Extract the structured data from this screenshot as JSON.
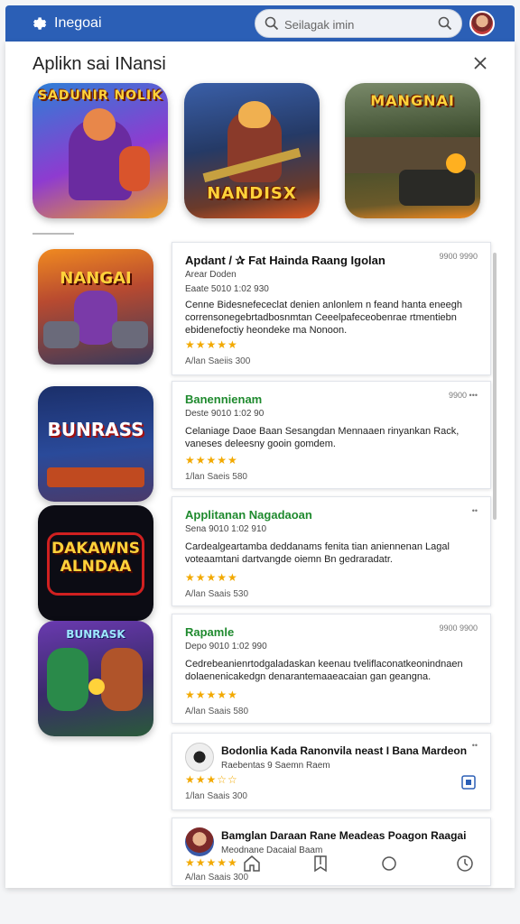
{
  "header": {
    "app_name": "Inegoai",
    "search_placeholder": "Seilagak imin",
    "icons": [
      "gear-icon",
      "search-icon",
      "avatar"
    ]
  },
  "sheet": {
    "title": "Aplikn sai INansi",
    "close_icon": "close-icon"
  },
  "featured": [
    {
      "art_text": "SADUNIR NOLIK",
      "colors": [
        "#2d7fd6",
        "#8e3bd0",
        "#f0a020"
      ]
    },
    {
      "art_text": "NANDISX",
      "colors": [
        "#253a66",
        "#6b3a2a",
        "#e05a22"
      ]
    },
    {
      "art_text": "MANGNAI",
      "colors": [
        "#3a4a2c",
        "#6b5a2a",
        "#f08a20"
      ]
    }
  ],
  "list": [
    {
      "art_text": "NANGAI",
      "title": "Apdant / ✰ Fat Hainda Raang Igolan",
      "title_color": "dark",
      "sub": "Arear Doden",
      "sub2": "Eaate  5010 1:02 930",
      "meta": "9900   9990",
      "desc": "Cenne Bidesnefececlat denien anlonlem n feand hanta eneegh corrensonegebrtadbosnmtan Ceeelpafeceobenrae rtmentiebn ebidenefoctiy heondeke ma Nonoon.",
      "stars": "★★★★★",
      "foot": "A/lan   Saeiis   300"
    },
    {
      "art_text": "BUNRASS",
      "title": "Banennienam",
      "title_color": "green",
      "sub2": "Deste  9010 1:02 90",
      "meta": "9900   •••",
      "desc": "Celaniage Daoe  Baan Sesangdan Mennaaen rinyankan Rack, vaneses deleesny gooin gomdem.",
      "stars": "★★★★★",
      "foot": "1/lan   Saeis   580"
    },
    {
      "art_text": "DAKAWNS ALNDAA",
      "title": "Applitanan Nagadaoan",
      "title_color": "green",
      "sub2": "Sena  9010 1:02 910",
      "meta": "••",
      "desc": "Cardealgeartamba deddanams fenita tian aniennenan Lagal voteaamtani dartvangde oiemn Bn gedraradatr.",
      "stars": "★★★★★",
      "foot": "A/lan   Saais   530"
    },
    {
      "art_text": "BUNRASK",
      "title": "Rapamle",
      "title_color": "green",
      "sub2": "Depo  9010 1:02 990",
      "meta": "9900   9900",
      "desc": "Cedrebeanienrtodgaladaskan keenau tveliflaconatkeonindnaen dolaenenicakedgn denarantemaaeacaian gan geangna.",
      "stars": "★★★★★",
      "foot": "A/lan   Saais   580"
    }
  ],
  "compact": [
    {
      "title": "Bodonlia Kada Ranonvila neast I Bana Mardeon",
      "sub": "Raebentas 9 Saemn  Raem",
      "meta": "••",
      "stars": "★★★☆☆",
      "foot": "1/lan   Saais   300",
      "action_icon": "open-icon"
    },
    {
      "title": "Bamglan Daraan Rane Meadeas Poagon Raagai",
      "sub": "Meodnane Dacaial  Baam",
      "stars": "★★★★★",
      "foot": "A/lan   Saais   300"
    }
  ],
  "bottom_nav": [
    "home-icon",
    "bookmark-icon",
    "circle-icon",
    "history-icon"
  ]
}
